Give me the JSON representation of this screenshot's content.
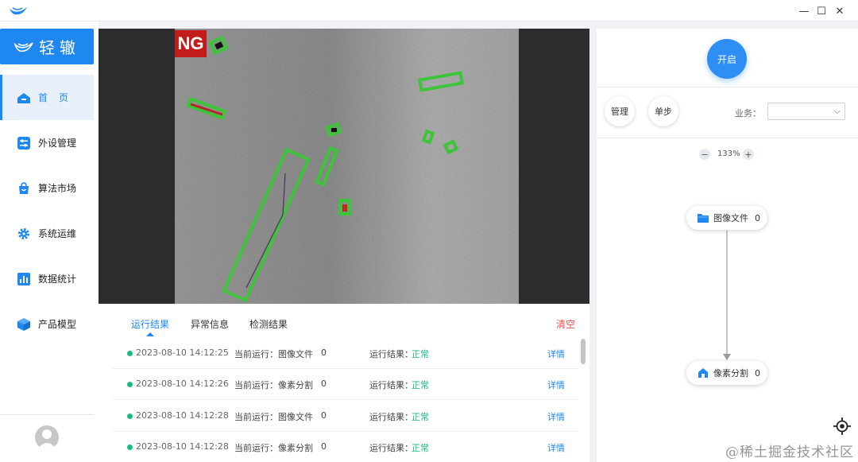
{
  "window": {
    "minimize_glyph": "—",
    "maximize_glyph": "☐",
    "close_glyph": "✕"
  },
  "sidebar": {
    "brand": "轻辙",
    "items": [
      {
        "label": "首页",
        "icon": "home-icon",
        "active": true
      },
      {
        "label": "外设管理",
        "icon": "sliders-icon"
      },
      {
        "label": "算法市场",
        "icon": "shopping-bag-icon"
      },
      {
        "label": "系统运维",
        "icon": "gear-icon"
      },
      {
        "label": "数据统计",
        "icon": "bar-chart-icon"
      },
      {
        "label": "产品模型",
        "icon": "cube-icon"
      }
    ]
  },
  "viewer": {
    "badge": "NG",
    "accent_green": "#3ec43a"
  },
  "results": {
    "tabs": [
      "运行结果",
      "异常信息",
      "检测结果"
    ],
    "clear_label": "清空",
    "rows": [
      {
        "time": "2023-08-10 14:12:25",
        "current": "当前运行：图像文件",
        "count": "0",
        "result_label": "运行结果：",
        "result": "正常",
        "detail": "详情"
      },
      {
        "time": "2023-08-10 14:12:26",
        "current": "当前运行：像素分割",
        "count": "0",
        "result_label": "运行结果：",
        "result": "正常",
        "detail": "详情"
      },
      {
        "time": "2023-08-10 14:12:28",
        "current": "当前运行：图像文件",
        "count": "0",
        "result_label": "运行结果：",
        "result": "正常",
        "detail": "详情"
      },
      {
        "time": "2023-08-10 14:12:28",
        "current": "当前运行：像素分割",
        "count": "0",
        "result_label": "运行结果：",
        "result": "正常",
        "detail": "详情"
      }
    ]
  },
  "right_panel": {
    "start_label": "开启",
    "manage_label": "管理",
    "step_label": "单步",
    "business_label": "业务：",
    "business_value": "",
    "zoom_out": "−",
    "zoom_level": "133%",
    "zoom_in": "+",
    "nodes": [
      {
        "label": "图像文件",
        "count": "0",
        "icon": "folder-icon"
      },
      {
        "label": "像素分割",
        "count": "0",
        "icon": "segment-icon"
      }
    ]
  },
  "watermark": "@稀土掘金技术社区",
  "colors": {
    "primary": "#1e88f0",
    "success": "#19b97f",
    "danger": "#f04d4d",
    "ng_red": "#c21c1c"
  }
}
